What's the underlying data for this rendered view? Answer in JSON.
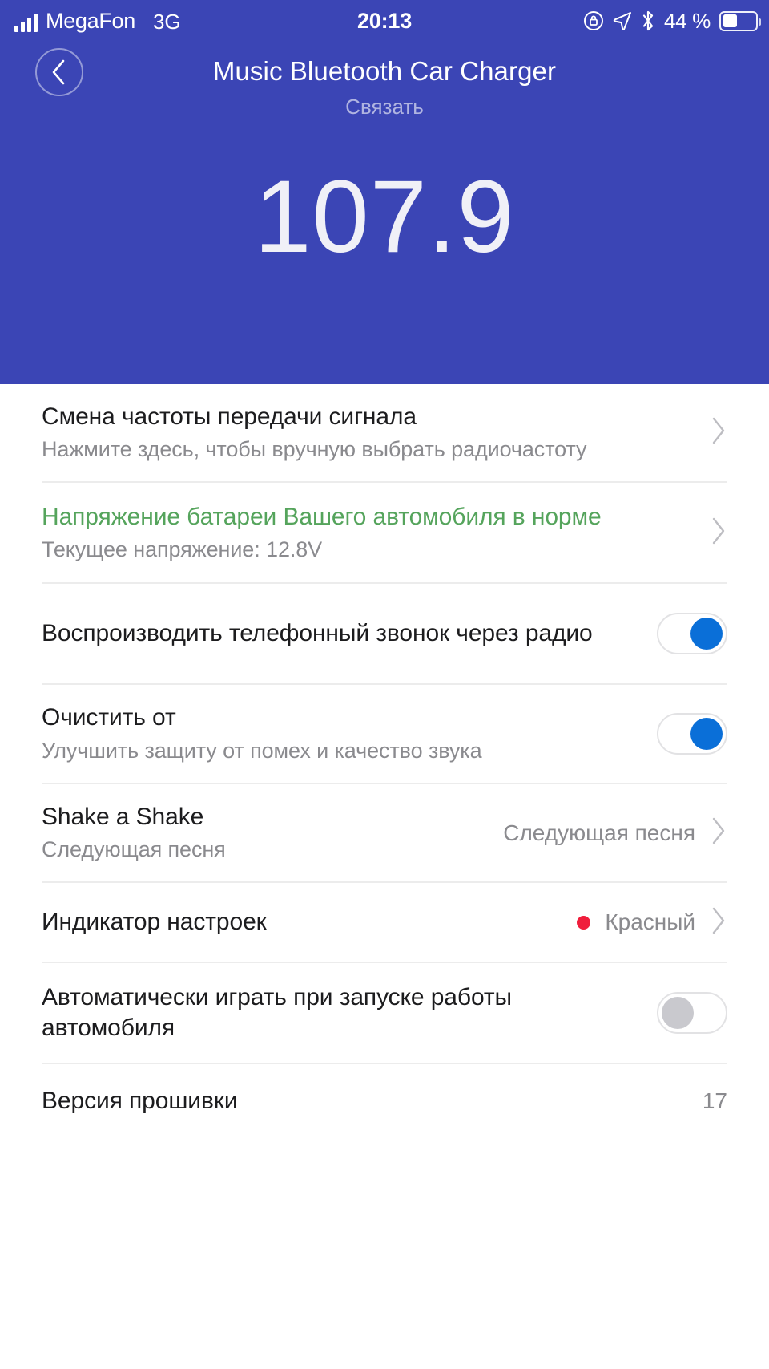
{
  "status_bar": {
    "carrier": "MegaFon",
    "network": "3G",
    "time": "20:13",
    "battery_percent": "44 %",
    "icons": [
      "signal-bars-icon",
      "rotation-lock-icon",
      "location-arrow-icon",
      "bluetooth-icon",
      "battery-icon"
    ]
  },
  "header": {
    "back_icon": "chevron-left-icon",
    "title": "Music Bluetooth Car Charger",
    "subtitle": "Связать",
    "frequency": "107.9"
  },
  "colors": {
    "brand": "#3B45B5",
    "accent_blue": "#0A6FD8",
    "status_green": "#55A45C",
    "indicator_red": "#F01E3C",
    "muted_text": "#8A8A8E",
    "divider": "#ECECEC"
  },
  "rows": [
    {
      "name": "change-frequency",
      "title": "Смена частоты передачи сигнала",
      "subtitle": "Нажмите здесь, чтобы вручную выбрать радиочастоту",
      "accessory": "chevron"
    },
    {
      "name": "battery-voltage",
      "title": "Напряжение батареи Вашего автомобиля в норме",
      "subtitle": "Текущее напряжение: 12.8V",
      "accessory": "chevron",
      "title_color": "green"
    },
    {
      "name": "play-call-over-radio",
      "title": "Воспроизводить телефонный звонок через радио",
      "subtitle": "",
      "accessory": "toggle",
      "toggle_on": true
    },
    {
      "name": "noise-clear",
      "title": "Очистить от",
      "subtitle": "Улучшить защиту от помех и качество звука",
      "accessory": "toggle",
      "toggle_on": true
    },
    {
      "name": "shake-a-shake",
      "title": "Shake a Shake",
      "subtitle": "Следующая песня",
      "value": "Следующая песня",
      "accessory": "chevron"
    },
    {
      "name": "indicator-settings",
      "title": "Индикатор настроек",
      "subtitle": "",
      "value": "Красный",
      "dot": "#F01E3C",
      "accessory": "chevron"
    },
    {
      "name": "autoplay-on-start",
      "title": "Автоматически играть при запуске работы автомобиля",
      "subtitle": "",
      "accessory": "toggle",
      "toggle_on": false
    },
    {
      "name": "firmware-version",
      "title": "Версия прошивки",
      "subtitle": "",
      "value": "17",
      "accessory": "none"
    }
  ]
}
